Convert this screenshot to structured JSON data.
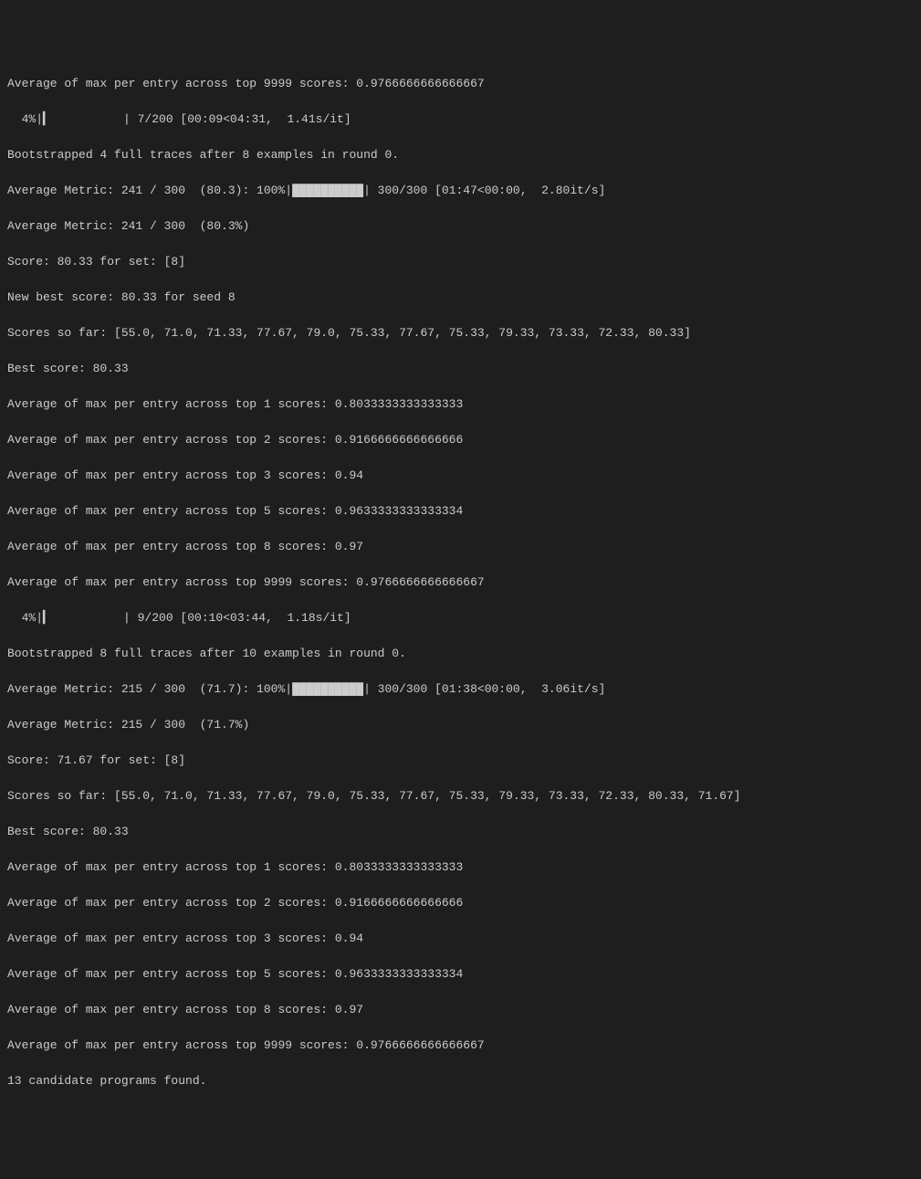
{
  "lines": {
    "l0": "Average of max per entry across top 9999 scores: 0.9766666666666667",
    "l1": "  4%|▎          | 7/200 [00:09<04:31,  1.41s/it]",
    "l2": "Bootstrapped 4 full traces after 8 examples in round 0.",
    "l3a": "Average Metric: 241 / 300  (80.3): 100%|",
    "l3b": "██████████",
    "l3c": "| 300/300 [01:47<00:00,  2.80it/s]",
    "l4": "Average Metric: 241 / 300  (80.3%)",
    "l5": "Score: 80.33 for set: [8]",
    "l6": "New best score: 80.33 for seed 8",
    "l7": "Scores so far: [55.0, 71.0, 71.33, 77.67, 79.0, 75.33, 77.67, 75.33, 79.33, 73.33, 72.33, 80.33]",
    "l8": "Best score: 80.33",
    "l9": "Average of max per entry across top 1 scores: 0.8033333333333333",
    "l10": "Average of max per entry across top 2 scores: 0.9166666666666666",
    "l11": "Average of max per entry across top 3 scores: 0.94",
    "l12": "Average of max per entry across top 5 scores: 0.9633333333333334",
    "l13": "Average of max per entry across top 8 scores: 0.97",
    "l14": "Average of max per entry across top 9999 scores: 0.9766666666666667",
    "l15": "  4%|▎          | 9/200 [00:10<03:44,  1.18s/it]",
    "l16": "Bootstrapped 8 full traces after 10 examples in round 0.",
    "l17a": "Average Metric: 215 / 300  (71.7): 100%|",
    "l17b": "██████████",
    "l17c": "| 300/300 [01:38<00:00,  3.06it/s]",
    "l18": "Average Metric: 215 / 300  (71.7%)",
    "l19": "Score: 71.67 for set: [8]",
    "l20": "Scores so far: [55.0, 71.0, 71.33, 77.67, 79.0, 75.33, 77.67, 75.33, 79.33, 73.33, 72.33, 80.33, 71.67]",
    "l21": "Best score: 80.33",
    "l22": "Average of max per entry across top 1 scores: 0.8033333333333333",
    "l23": "Average of max per entry across top 2 scores: 0.9166666666666666",
    "l24": "Average of max per entry across top 3 scores: 0.94",
    "l25": "Average of max per entry across top 5 scores: 0.9633333333333334",
    "l26": "Average of max per entry across top 8 scores: 0.97",
    "l27": "Average of max per entry across top 9999 scores: 0.9766666666666667",
    "l28": "13 candidate programs found."
  }
}
